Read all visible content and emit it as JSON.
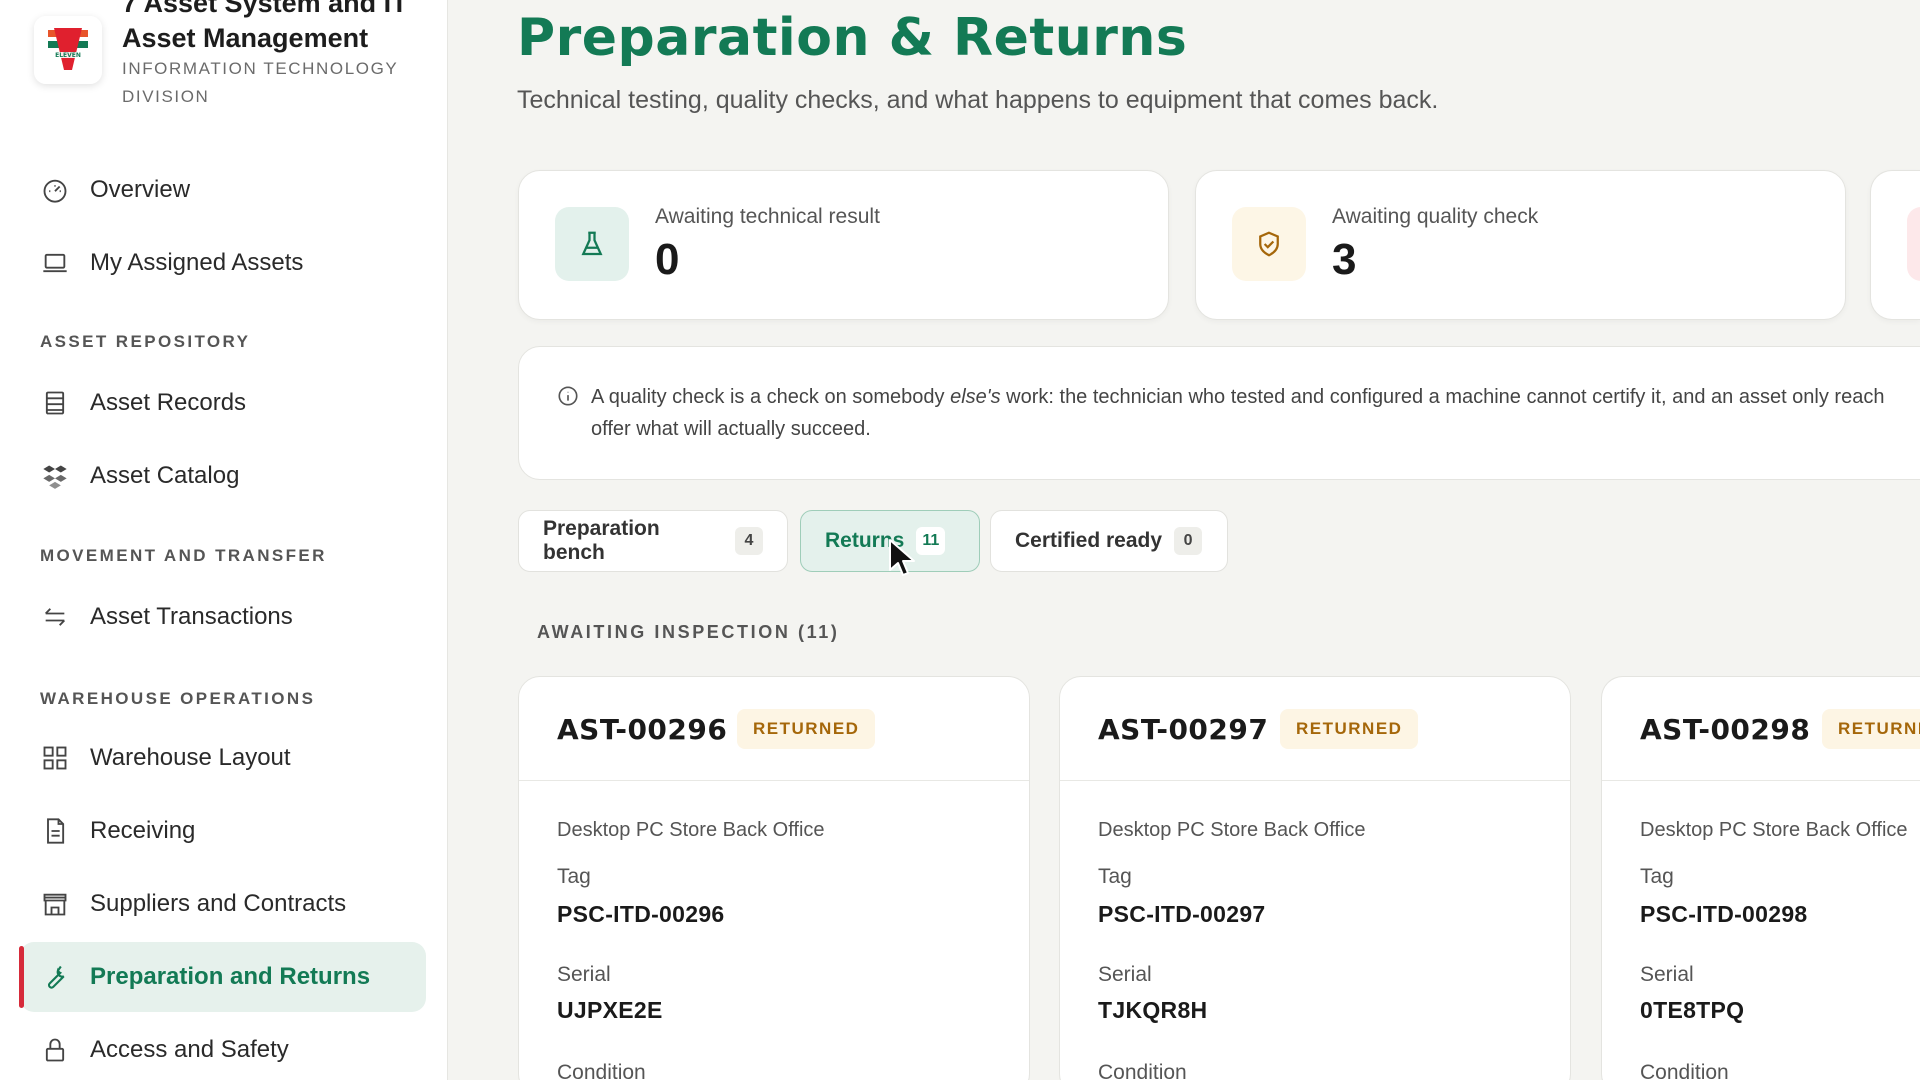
{
  "app": {
    "title": "7 Asset System and IT Asset Management",
    "division": "INFORMATION TECHNOLOGY DIVISION"
  },
  "sidebar": {
    "top_items": [
      {
        "label": "Overview",
        "icon": "gauge-icon"
      },
      {
        "label": "My Assigned Assets",
        "icon": "laptop-icon"
      }
    ],
    "sections": [
      {
        "label": "ASSET REPOSITORY",
        "items": [
          {
            "label": "Asset Records",
            "icon": "records-icon"
          },
          {
            "label": "Asset Catalog",
            "icon": "boxes-icon"
          }
        ]
      },
      {
        "label": "MOVEMENT AND TRANSFER",
        "items": [
          {
            "label": "Asset Transactions",
            "icon": "transfer-arrows-icon"
          }
        ]
      },
      {
        "label": "WAREHOUSE OPERATIONS",
        "items": [
          {
            "label": "Warehouse Layout",
            "icon": "grid-icon"
          },
          {
            "label": "Receiving",
            "icon": "document-icon"
          },
          {
            "label": "Suppliers and Contracts",
            "icon": "store-icon"
          },
          {
            "label": "Preparation and Returns",
            "icon": "wrench-icon",
            "active": true
          },
          {
            "label": "Access and Safety",
            "icon": "lock-icon"
          }
        ]
      }
    ]
  },
  "page": {
    "title": "Preparation & Returns",
    "subtitle": "Technical testing, quality checks, and what happens to equipment that comes back."
  },
  "stats": [
    {
      "label": "Awaiting technical result",
      "value": "0",
      "icon": "flask-icon"
    },
    {
      "label": "Awaiting quality check",
      "value": "3",
      "icon": "shield-check-icon"
    }
  ],
  "notice": {
    "before": "A quality check is a check on somebody ",
    "emphasis": "else's",
    "after": " work: the technician who tested and configured a machine cannot certify it, and an asset only reach",
    "line2": "offer what will actually succeed."
  },
  "tabs": [
    {
      "label": "Preparation bench",
      "count": "4"
    },
    {
      "label": "Returns",
      "count": "11",
      "active": true
    },
    {
      "label": "Certified ready",
      "count": "0"
    }
  ],
  "group": {
    "label": "AWAITING INSPECTION (11)"
  },
  "assets": [
    {
      "id": "AST-00296",
      "status": "RETURNED",
      "description": "Desktop PC Store Back Office",
      "tag_label": "Tag",
      "tag": "PSC-ITD-00296",
      "serial_label": "Serial",
      "serial": "UJPXE2E",
      "condition_label": "Condition"
    },
    {
      "id": "AST-00297",
      "status": "RETURNED",
      "description": "Desktop PC Store Back Office",
      "tag_label": "Tag",
      "tag": "PSC-ITD-00297",
      "serial_label": "Serial",
      "serial": "TJKQR8H",
      "condition_label": "Condition"
    },
    {
      "id": "AST-00298",
      "status": "RETURNE",
      "description": "Desktop PC Store Back Office",
      "tag_label": "Tag",
      "tag": "PSC-ITD-00298",
      "serial_label": "Serial",
      "serial": "0TE8TPQ",
      "condition_label": "Condition"
    }
  ],
  "colors": {
    "accent": "#137a55",
    "active_marker": "#d62b3a",
    "returned_badge_bg": "#fdf5e4",
    "returned_badge_text": "#a5670a"
  }
}
